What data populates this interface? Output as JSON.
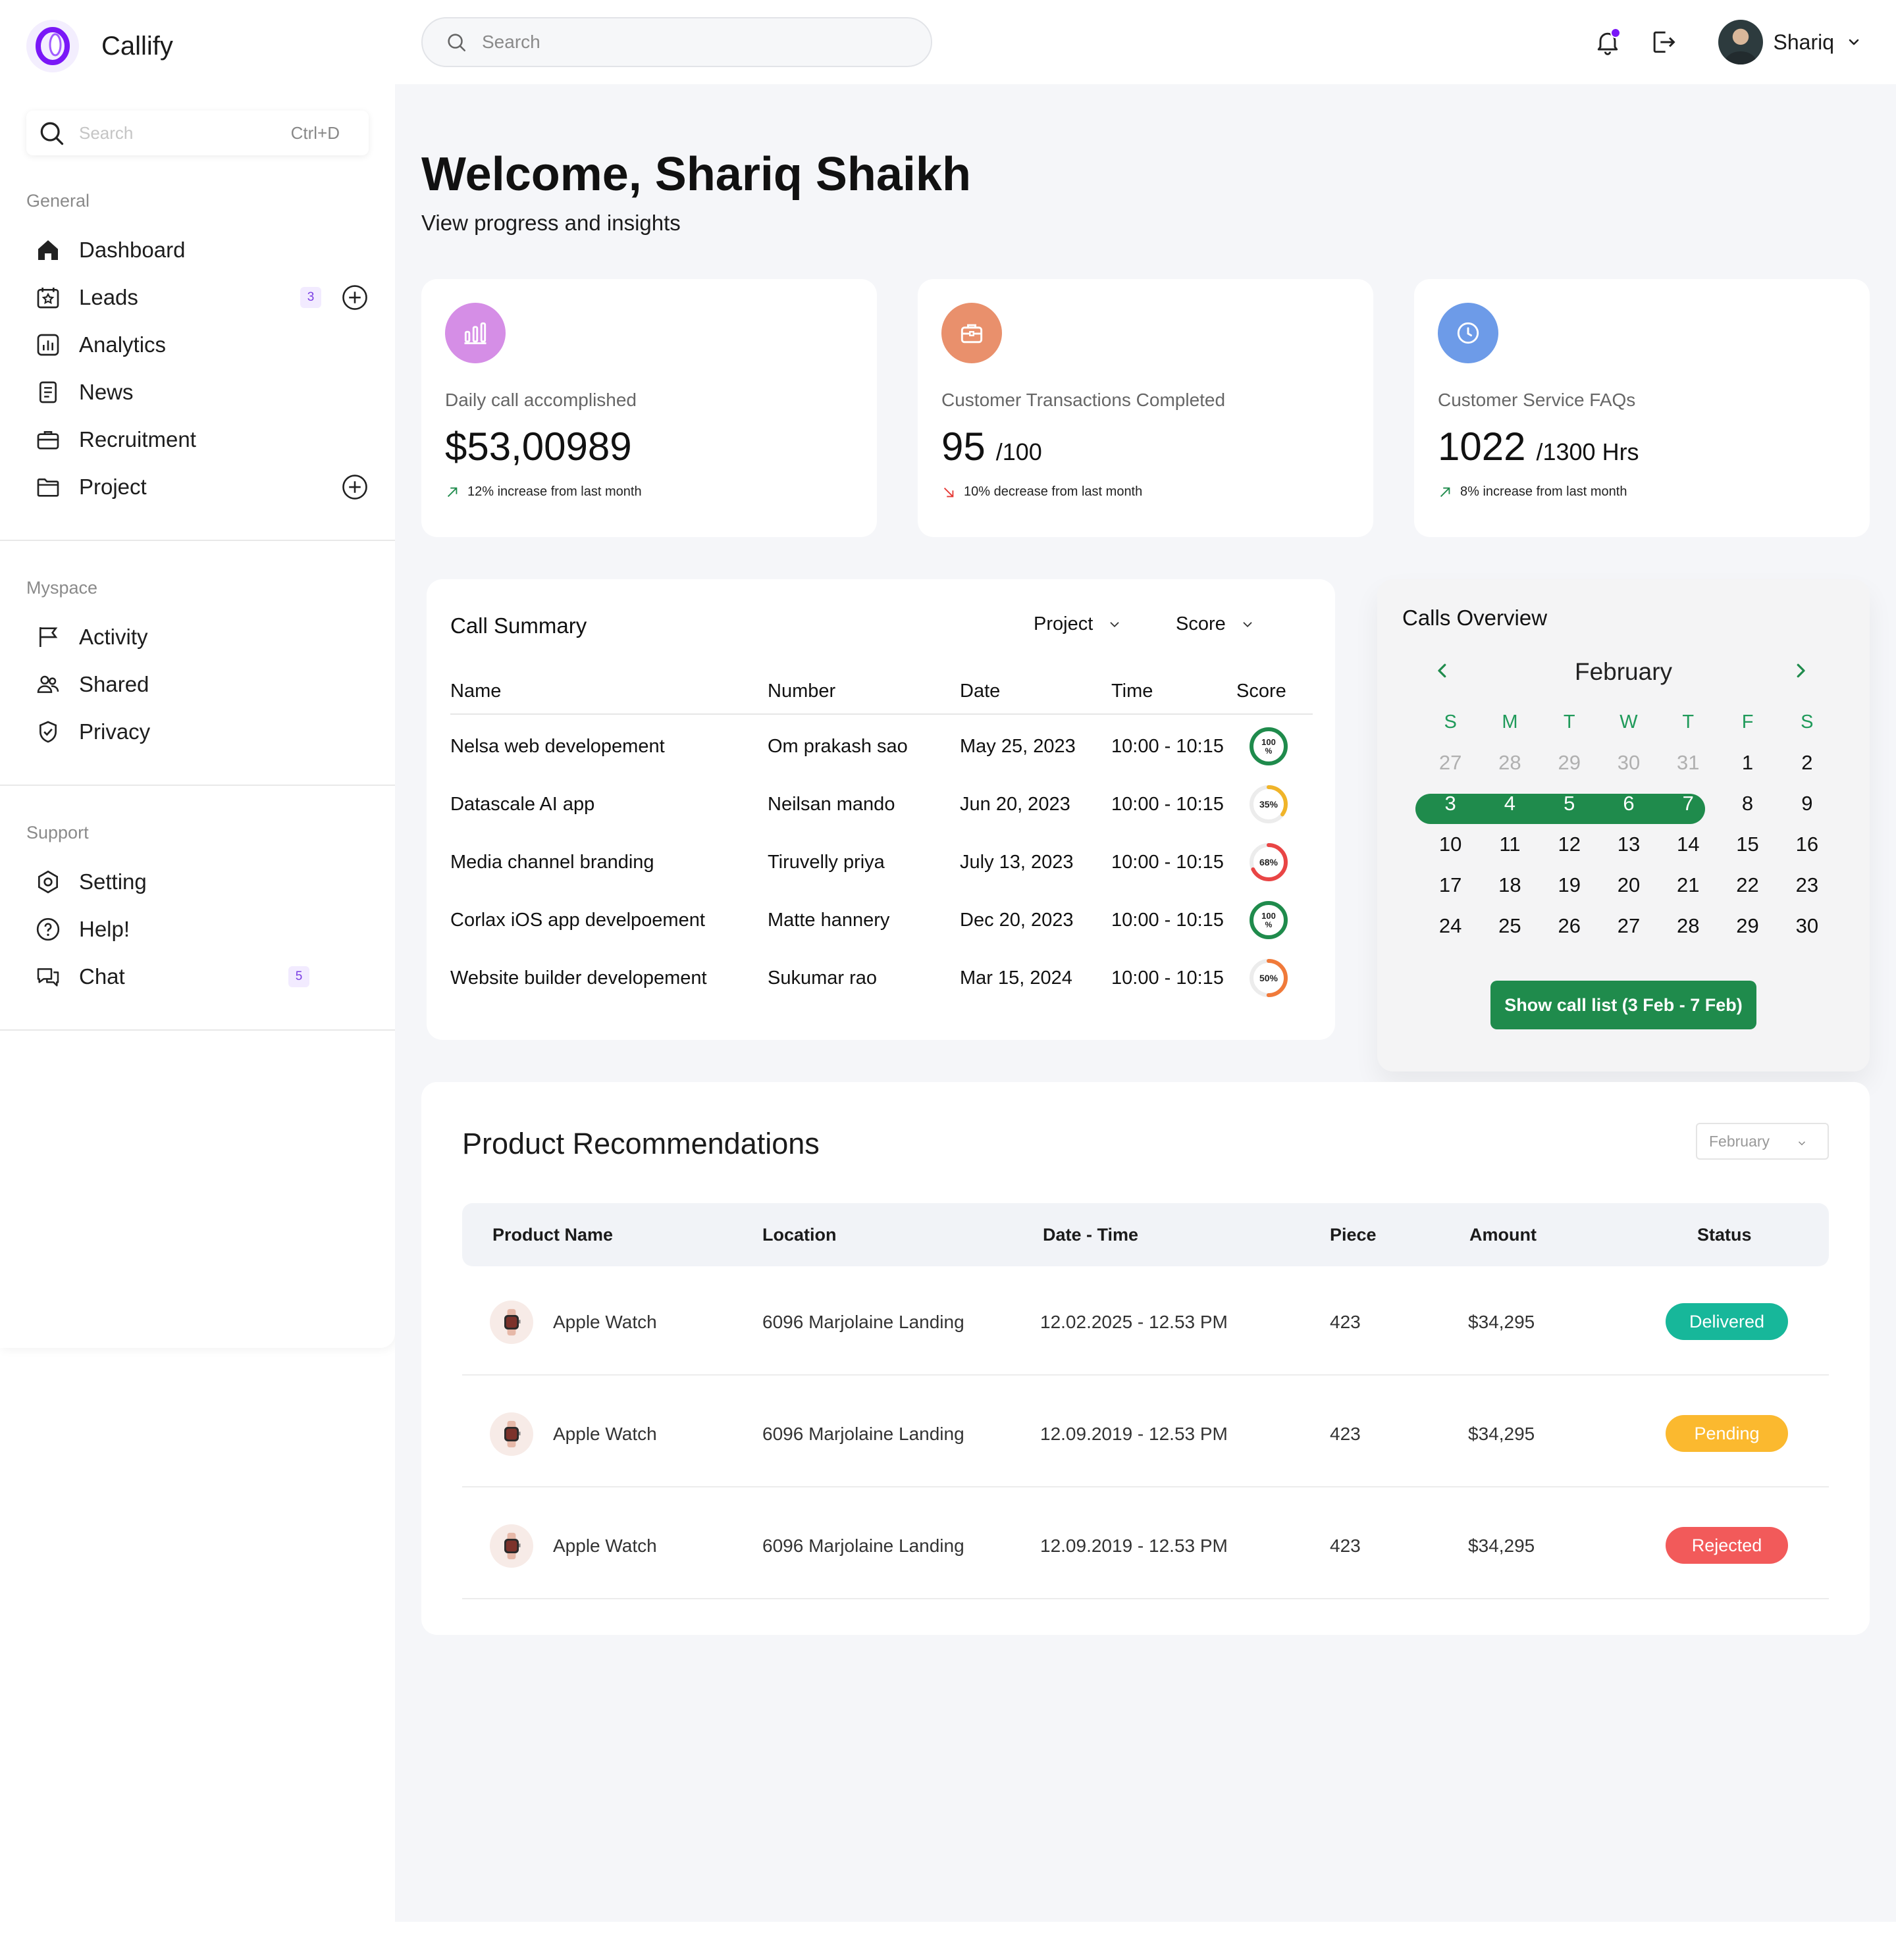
{
  "app": {
    "name": "Callify",
    "accent": "#7a17f7"
  },
  "sidebar": {
    "search_placeholder": "Search",
    "search_shortcut": "Ctrl+D",
    "sections": {
      "general": "General",
      "myspace": "Myspace",
      "support": "Support"
    },
    "general": [
      {
        "label": "Dashboard",
        "icon": "home-icon"
      },
      {
        "label": "Leads",
        "icon": "leads-icon",
        "badge": "3"
      },
      {
        "label": "Analytics",
        "icon": "analytics-icon"
      },
      {
        "label": "News",
        "icon": "news-icon"
      },
      {
        "label": "Recruitment",
        "icon": "briefcase-icon"
      },
      {
        "label": "Project",
        "icon": "folder-icon"
      }
    ],
    "myspace": [
      {
        "label": "Activity",
        "icon": "flag-icon"
      },
      {
        "label": "Shared",
        "icon": "users-icon"
      },
      {
        "label": "Privacy",
        "icon": "shield-icon"
      }
    ],
    "support": [
      {
        "label": "Setting",
        "icon": "gear-icon"
      },
      {
        "label": "Help!",
        "icon": "help-icon"
      },
      {
        "label": "Chat",
        "icon": "chat-icon",
        "badge": "5"
      }
    ]
  },
  "topbar": {
    "search_placeholder": "Search",
    "user_name": "Shariq"
  },
  "header": {
    "title": "Welcome, Shariq Shaikh",
    "subtitle": "View progress and insights"
  },
  "stats": [
    {
      "label": "Daily call accomplished",
      "value": "$53,00989",
      "unit": "",
      "trend": "12% increase from last month",
      "direction": "up",
      "color": "#d58ee6",
      "icon": "bar-chart-icon"
    },
    {
      "label": "Customer Transactions Completed",
      "value": "95",
      "unit": "/100",
      "trend": "10% decrease from last month",
      "direction": "down",
      "color": "#e9906c",
      "icon": "briefcase-icon"
    },
    {
      "label": "Customer Service FAQs",
      "value": "1022",
      "unit": "/1300 Hrs",
      "trend": "8% increase from last month",
      "direction": "up",
      "color": "#6d9be8",
      "icon": "clock-icon"
    }
  ],
  "call_summary": {
    "title": "Call Summary",
    "filters": [
      "Project",
      "Score"
    ],
    "columns": [
      "Name",
      "Number",
      "Date",
      "Time",
      "Score"
    ],
    "rows": [
      {
        "name": "Nelsa web developement",
        "number": "Om prakash sao",
        "date": "May 25, 2023",
        "time": "10:00 - 10:15",
        "score": 100,
        "score_label": "100 %",
        "color": "#1f8b4c"
      },
      {
        "name": "Datascale AI app",
        "number": "Neilsan mando",
        "date": "Jun 20, 2023",
        "time": "10:00 - 10:15",
        "score": 35,
        "score_label": "35%",
        "color": "#f0b429"
      },
      {
        "name": "Media channel branding",
        "number": "Tiruvelly priya",
        "date": "July 13, 2023",
        "time": "10:00 - 10:15",
        "score": 68,
        "score_label": "68%",
        "color": "#e94545"
      },
      {
        "name": "Corlax iOS app develpoement",
        "number": "Matte hannery",
        "date": "Dec 20, 2023",
        "time": "10:00 - 10:15",
        "score": 100,
        "score_label": "100 %",
        "color": "#1f8b4c"
      },
      {
        "name": "Website builder developement",
        "number": "Sukumar rao",
        "date": "Mar 15, 2024",
        "time": "10:00 - 10:15",
        "score": 50,
        "score_label": "50%",
        "color": "#f07a3a"
      }
    ]
  },
  "calendar": {
    "title": "Calls Overview",
    "month": "February",
    "weekdays": [
      "S",
      "M",
      "T",
      "W",
      "T",
      "F",
      "S"
    ],
    "weeks": [
      [
        "27",
        "28",
        "29",
        "30",
        "31",
        "1",
        "2"
      ],
      [
        "3",
        "4",
        "5",
        "6",
        "7",
        "8",
        "9"
      ],
      [
        "10",
        "11",
        "12",
        "13",
        "14",
        "15",
        "16"
      ],
      [
        "17",
        "18",
        "19",
        "20",
        "21",
        "22",
        "23"
      ],
      [
        "24",
        "25",
        "26",
        "27",
        "28",
        "29",
        "30"
      ]
    ],
    "muted_first_week": 5,
    "selected_range": [
      "3",
      "7"
    ],
    "button": "Show call list (3 Feb - 7 Feb)",
    "accent": "#1f8b4c"
  },
  "products": {
    "title": "Product Recommendations",
    "month_select": "February",
    "columns": [
      "Product Name",
      "Location",
      "Date - Time",
      "Piece",
      "Amount",
      "Status"
    ],
    "rows": [
      {
        "name": "Apple Watch",
        "location": "6096 Marjolaine Landing",
        "datetime": "12.02.2025 - 12.53 PM",
        "piece": "423",
        "amount": "$34,295",
        "status": "Delivered",
        "status_color": "#17b79a"
      },
      {
        "name": "Apple Watch",
        "location": "6096 Marjolaine Landing",
        "datetime": "12.09.2019 - 12.53 PM",
        "piece": "423",
        "amount": "$34,295",
        "status": "Pending",
        "status_color": "#fbb92f"
      },
      {
        "name": "Apple Watch",
        "location": "6096 Marjolaine Landing",
        "datetime": "12.09.2019 - 12.53 PM",
        "piece": "423",
        "amount": "$34,295",
        "status": "Rejected",
        "status_color": "#f25a5a"
      }
    ]
  }
}
